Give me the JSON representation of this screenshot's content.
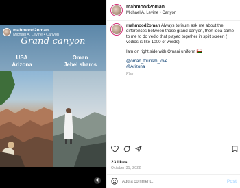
{
  "video": {
    "overlay_username": "mahmood2oman",
    "overlay_subtitle": "Michael A. Levine • Canyon",
    "title": "Grand canyon",
    "left_label_line1": "USA",
    "left_label_line2": "Arizona",
    "right_label_line1": "Oman",
    "right_label_line2": "Jebel shams"
  },
  "header": {
    "username": "mahmood2oman",
    "location": "Michael A. Levine • Canyon"
  },
  "caption": {
    "username": "mahmood2oman",
    "text1": "Always torisum ask me about the differences between those grand canyon, then idea came to me to do vedio that played together in split screen ( vedios is like 1000 of words).",
    "text2": "Iam on right side with Omani uniform 🇴🇲",
    "tag1": "@oman_tourism_love",
    "tag2": "@Arizona",
    "time": "87w"
  },
  "stats": {
    "likes": "23 likes",
    "date": "October 31, 2022"
  },
  "comment": {
    "placeholder": "Add a comment...",
    "post_label": "Post"
  },
  "colors": {
    "accent_link": "#00376b",
    "post_button": "#b3dbff"
  }
}
